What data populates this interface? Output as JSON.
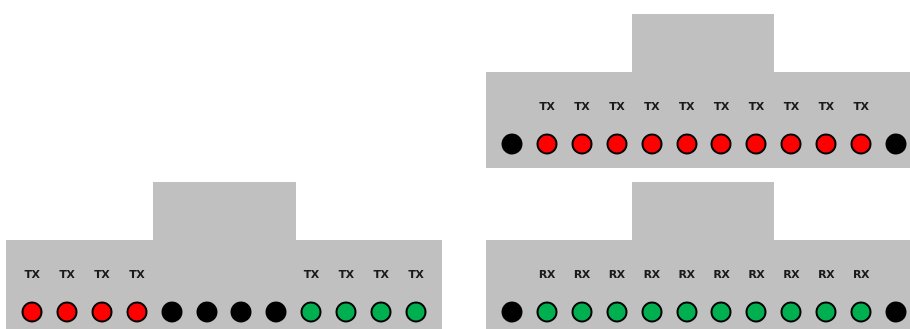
{
  "colors": {
    "panel": "#c0c0c0",
    "red": "#ff0000",
    "black": "#000000",
    "green": "#00b050"
  },
  "panels": [
    {
      "id": "panel-top-right",
      "labels": [
        "",
        "TX",
        "TX",
        "TX",
        "TX",
        "TX",
        "TX",
        "TX",
        "TX",
        "TX",
        "TX",
        ""
      ],
      "leds": [
        "black",
        "red",
        "red",
        "red",
        "red",
        "red",
        "red",
        "red",
        "red",
        "red",
        "red",
        "black"
      ]
    },
    {
      "id": "panel-bottom-left",
      "labels": [
        "TX",
        "TX",
        "TX",
        "TX",
        "",
        "",
        "",
        "",
        "TX",
        "TX",
        "TX",
        "TX"
      ],
      "leds": [
        "red",
        "red",
        "red",
        "red",
        "black",
        "black",
        "black",
        "black",
        "green",
        "green",
        "green",
        "green"
      ]
    },
    {
      "id": "panel-bottom-right",
      "labels": [
        "",
        "RX",
        "RX",
        "RX",
        "RX",
        "RX",
        "RX",
        "RX",
        "RX",
        "RX",
        "RX",
        ""
      ],
      "leds": [
        "black",
        "green",
        "green",
        "green",
        "green",
        "green",
        "green",
        "green",
        "green",
        "green",
        "green",
        "black"
      ]
    }
  ]
}
